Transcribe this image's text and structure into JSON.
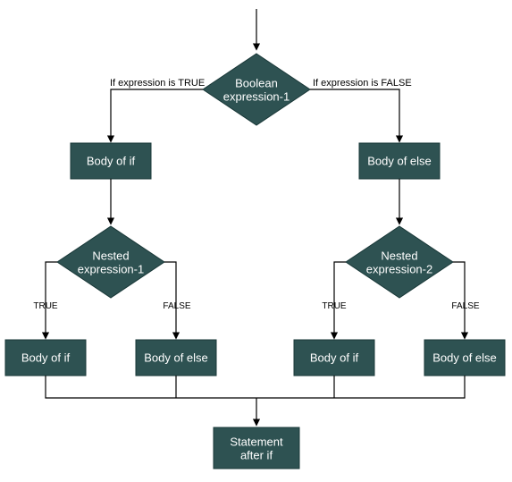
{
  "nodes": {
    "top_decision": {
      "line1": "Boolean",
      "line2": "expression-1"
    },
    "body_if": "Body of if",
    "body_else": "Body of else",
    "nested1": {
      "line1": "Nested",
      "line2": "expression-1"
    },
    "nested2": {
      "line1": "Nested",
      "line2": "expression-2"
    },
    "n1_if": "Body of if",
    "n1_else": "Body of else",
    "n2_if": "Body of if",
    "n2_else": "Body of else",
    "final": {
      "line1": "Statement",
      "line2": "after if"
    }
  },
  "labels": {
    "true_expr": "If expression is TRUE",
    "false_expr": "If expression  is FALSE",
    "true": "TRUE",
    "false": "FALSE"
  }
}
